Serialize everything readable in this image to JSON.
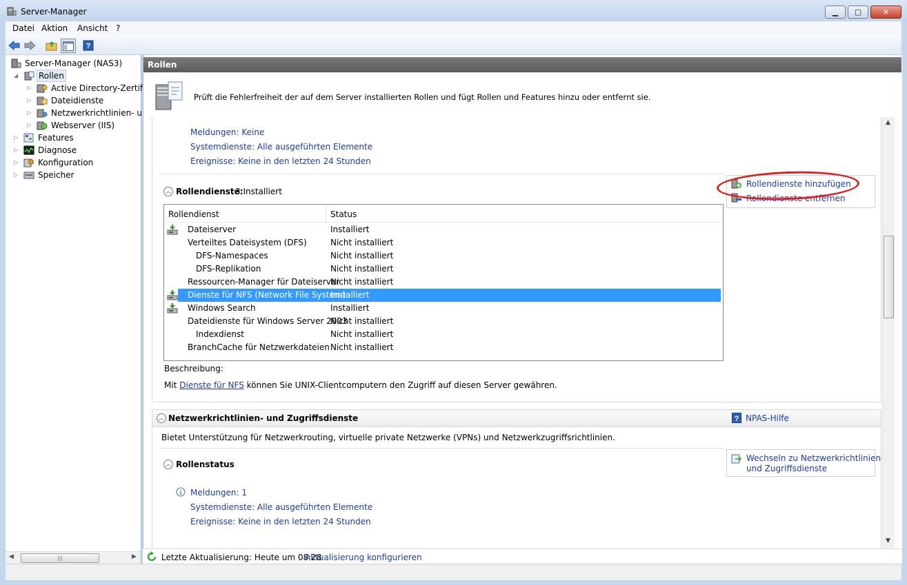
{
  "window": {
    "title": "Server-Manager"
  },
  "menu": [
    "Datei",
    "Aktion",
    "Ansicht",
    "?"
  ],
  "tree": {
    "root": "Server-Manager (NAS3)",
    "items": [
      {
        "label": "Rollen",
        "selected": true
      },
      {
        "label": "Active Directory-Zertifika"
      },
      {
        "label": "Dateidienste"
      },
      {
        "label": "Netzwerkrichtlinien- und"
      },
      {
        "label": "Webserver (IIS)"
      },
      {
        "label": "Features"
      },
      {
        "label": "Diagnose"
      },
      {
        "label": "Konfiguration"
      },
      {
        "label": "Speicher"
      }
    ]
  },
  "main": {
    "header": "Rollen",
    "intro": "Prüft die Fehlerfreiheit der auf dem Server installierten Rollen und fügt Rollen und Features hinzu oder entfernt sie.",
    "status_links": {
      "meldungen": "Meldungen: Keine",
      "systemdienste": "Systemdienste: Alle ausgeführten Elemente",
      "ereignisse": "Ereignisse: Keine in den letzten 24 Stunden"
    },
    "rollendienste": {
      "title": "Rollendienste:",
      "count": "3 Installiert",
      "add_link": "Rollendienste hinzufügen",
      "remove_link": "Rollendienste entfernen",
      "columns": [
        "Rollendienst",
        "Status"
      ],
      "rows": [
        {
          "name": "Dateiserver",
          "status": "Installiert",
          "installed": true,
          "indent": 0
        },
        {
          "name": "Verteiltes Dateisystem (DFS)",
          "status": "Nicht installiert",
          "installed": false,
          "indent": 0
        },
        {
          "name": "DFS-Namespaces",
          "status": "Nicht installiert",
          "installed": false,
          "indent": 1
        },
        {
          "name": "DFS-Replikation",
          "status": "Nicht installiert",
          "installed": false,
          "indent": 1
        },
        {
          "name": "Ressourcen-Manager für Dateiserver",
          "status": "Nicht installiert",
          "installed": false,
          "indent": 0
        },
        {
          "name": "Dienste für NFS (Network File System)",
          "status": "Installiert",
          "installed": true,
          "indent": 0,
          "selected": true
        },
        {
          "name": "Windows Search",
          "status": "Installiert",
          "installed": true,
          "indent": 0
        },
        {
          "name": "Dateidienste für Windows Server 2003",
          "status": "Nicht installiert",
          "installed": false,
          "indent": 0
        },
        {
          "name": "Indexdienst",
          "status": "Nicht installiert",
          "installed": false,
          "indent": 1
        },
        {
          "name": "BranchCache für Netzwerkdateien",
          "status": "Nicht installiert",
          "installed": false,
          "indent": 0
        }
      ],
      "beschreibung_label": "Beschreibung:",
      "desc_prefix": "Mit",
      "desc_link": "Dienste für NFS",
      "desc_suffix": "können Sie UNIX-Clientcomputern den Zugriff auf diesen Server gewähren."
    },
    "npas": {
      "title": "Netzwerkrichtlinien- und Zugriffsdienste",
      "help_link": "NPAS-Hilfe",
      "description": "Bietet Unterstützung für Netzwerkrouting, virtuelle private Netzwerke (VPNs) und Netzwerkzugriffsrichtlinien.",
      "rollenstatus": "Rollenstatus",
      "switch_link_line1": "Wechseln zu Netzwerkrichtlinien-",
      "switch_link_line2": "und Zugriffsdienste",
      "meldungen": "Meldungen: 1",
      "systemdienste": "Systemdienste: Alle ausgeführten Elemente",
      "ereignisse": "Ereignisse: Keine in den letzten 24 Stunden"
    }
  },
  "statusbar": {
    "last_update": "Letzte Aktualisierung: Heute um 08:28",
    "configure_link": "Aktualisierung konfigurieren"
  },
  "icons": {
    "app": "server-manager-icon",
    "back": "back-arrow-icon",
    "forward": "forward-arrow-icon",
    "up": "folder-up-icon",
    "showhide": "show-hide-console-tree-icon",
    "help": "help-icon",
    "refresh": "refresh-icon"
  },
  "colors": {
    "link": "#1a3ba8",
    "selection": "#3399ff",
    "annotation": "#e01e1e",
    "header": "#6a6a6a"
  }
}
